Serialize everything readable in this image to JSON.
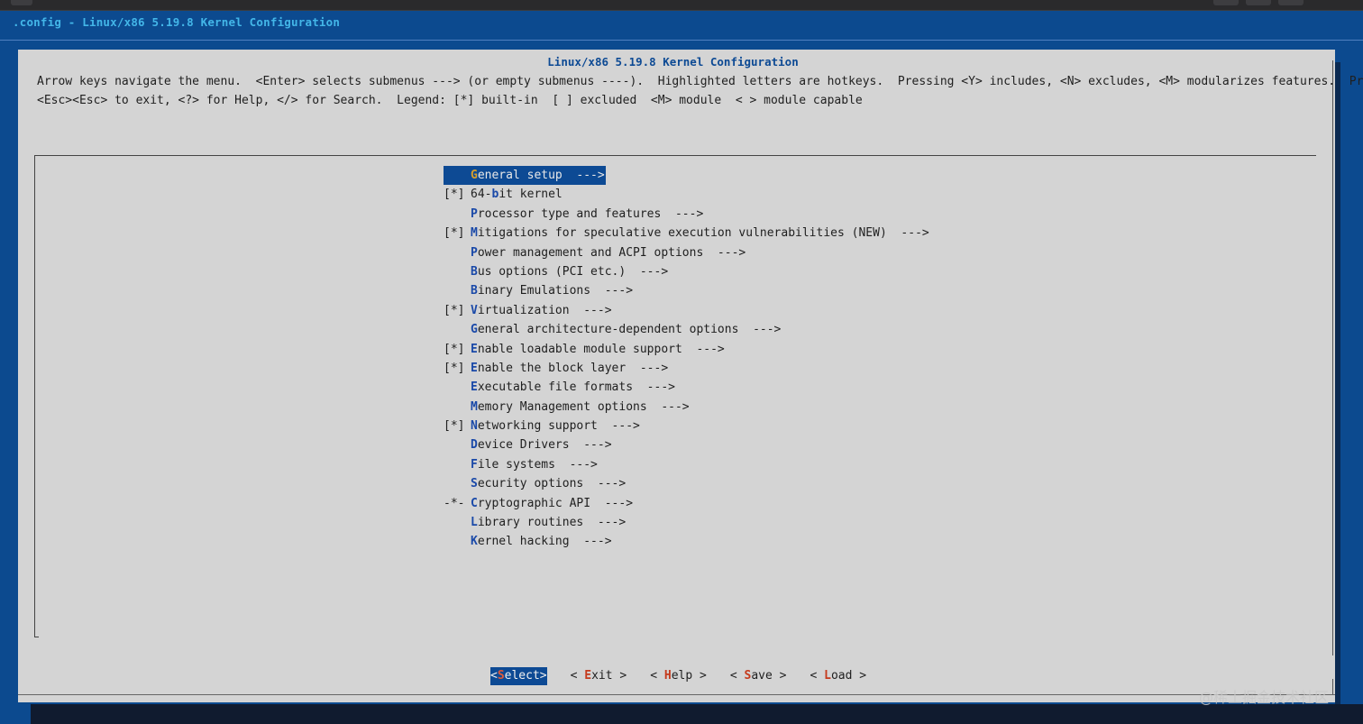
{
  "window": {
    "title": ".config - Linux/x86 5.19.8 Kernel Configuration"
  },
  "dialog": {
    "title": "Linux/x86 5.19.8 Kernel Configuration",
    "help_line1": "Arrow keys navigate the menu.  <Enter> selects submenus ---> (or empty submenus ----).  Highlighted letters are hotkeys.  Pressing <Y> includes, <N> excludes, <M> modularizes features.  Press",
    "help_line2": "<Esc><Esc> to exit, <?> for Help, </> for Search.  Legend: [*] built-in  [ ] excluded  <M> module  < > module capable"
  },
  "menu": {
    "selected_index": 0,
    "items": [
      {
        "prefix": "",
        "hot": "G",
        "rest": "eneral setup  --->"
      },
      {
        "prefix": "[*]",
        "pre": "64-",
        "hot": "b",
        "rest": "it kernel"
      },
      {
        "prefix": "",
        "hot": "P",
        "rest": "rocessor type and features  --->"
      },
      {
        "prefix": "[*]",
        "hot": "M",
        "rest": "itigations for speculative execution vulnerabilities (NEW)  --->"
      },
      {
        "prefix": "",
        "hot": "P",
        "rest": "ower management and ACPI options  --->"
      },
      {
        "prefix": "",
        "hot": "B",
        "rest": "us options (PCI etc.)  --->"
      },
      {
        "prefix": "",
        "hot": "B",
        "rest": "inary Emulations  --->"
      },
      {
        "prefix": "[*]",
        "hot": "V",
        "rest": "irtualization  --->"
      },
      {
        "prefix": "",
        "hot": "G",
        "rest": "eneral architecture-dependent options  --->"
      },
      {
        "prefix": "[*]",
        "hot": "E",
        "rest": "nable loadable module support  --->"
      },
      {
        "prefix": "[*]",
        "hot": "E",
        "rest": "nable the block layer  --->"
      },
      {
        "prefix": "",
        "hot": "E",
        "rest": "xecutable file formats  --->"
      },
      {
        "prefix": "",
        "hot": "M",
        "rest": "emory Management options  --->"
      },
      {
        "prefix": "[*]",
        "hot": "N",
        "rest": "etworking support  --->"
      },
      {
        "prefix": "",
        "hot": "D",
        "rest": "evice Drivers  --->"
      },
      {
        "prefix": "",
        "hot": "F",
        "rest": "ile systems  --->"
      },
      {
        "prefix": "",
        "hot": "S",
        "rest": "ecurity options  --->"
      },
      {
        "prefix": "-*-",
        "hot": "C",
        "rest": "ryptographic API  --->"
      },
      {
        "prefix": "",
        "hot": "L",
        "rest": "ibrary routines  --->"
      },
      {
        "prefix": "",
        "hot": "K",
        "rest": "ernel hacking  --->"
      }
    ]
  },
  "buttons": [
    {
      "pre": "<",
      "hot": "S",
      "post": "elect>",
      "selected": true
    },
    {
      "pre": "< ",
      "hot": "E",
      "post": "xit >",
      "selected": false
    },
    {
      "pre": "< ",
      "hot": "H",
      "post": "elp >",
      "selected": false
    },
    {
      "pre": "< ",
      "hot": "S",
      "post": "ave >",
      "selected": false
    },
    {
      "pre": "< ",
      "hot": "L",
      "post": "oad >",
      "selected": false
    }
  ],
  "watermark": "@稀土掘金技术社区",
  "colors": {
    "background": "#0c4a8f",
    "dialog": "#d4d4d4",
    "highlight": "#0d4a94",
    "hotkey": "#1a49a8",
    "button_hotkey": "#c53a1c"
  }
}
